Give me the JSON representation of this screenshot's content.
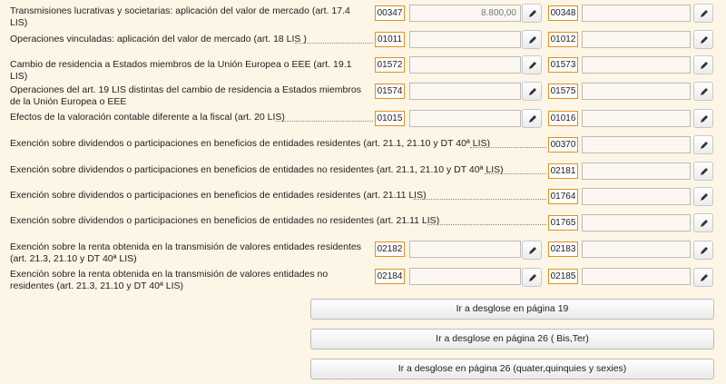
{
  "rows": [
    {
      "label": "Transmisiones lucrativas y societarias: aplicación del valor de mercado (art. 17.4 LIS)",
      "code1": "00347",
      "value1": "8.800,00",
      "code2": "00348",
      "value2": ""
    },
    {
      "label": "Operaciones vinculadas: aplicación del valor de mercado (art. 18 LIS )",
      "code1": "01011",
      "value1": "",
      "code2": "01012",
      "value2": ""
    },
    {
      "label": "Cambio de residencia a Estados miembros de la Unión Europea o EEE (art. 19.1 LIS)",
      "code1": "01572",
      "value1": "",
      "code2": "01573",
      "value2": ""
    },
    {
      "label": "Operaciones del art. 19 LIS distintas del cambio de residencia a Estados miembros de la Unión Europea o EEE",
      "code1": "01574",
      "value1": "",
      "code2": "01575",
      "value2": ""
    },
    {
      "label": "Efectos de la valoración contable diferente a la fiscal (art. 20 LIS)",
      "code1": "01015",
      "value1": "",
      "code2": "01016",
      "value2": ""
    },
    {
      "label": "Exención sobre dividendos o participaciones en beneficios de entidades residentes (art. 21.1, 21.10 y DT 40ª LIS)",
      "code2": "00370",
      "value2": ""
    },
    {
      "label": "Exención sobre dividendos o participaciones en beneficios de entidades no residentes (art. 21.1, 21.10 y DT 40ª LIS)",
      "code2": "02181",
      "value2": ""
    },
    {
      "label": "Exención sobre dividendos o participaciones en beneficios de entidades residentes (art. 21.11 LIS)",
      "code2": "01764",
      "value2": ""
    },
    {
      "label": "Exención sobre dividendos o participaciones en beneficios de entidades no residentes (art. 21.11 LIS)",
      "code2": "01765",
      "value2": ""
    },
    {
      "label": "Exención sobre la renta obtenida en la transmisión de valores entidades residentes (art. 21.3, 21.10 y DT 40ª LIS)",
      "code1": "02182",
      "value1": "",
      "code2": "02183",
      "value2": ""
    },
    {
      "label": "Exención sobre la renta obtenida en la transmisión de valores entidades no residentes (art. 21.3, 21.10 y DT 40ª LIS)",
      "code1": "02184",
      "value1": "",
      "code2": "02185",
      "value2": ""
    }
  ],
  "buttons": {
    "page19": "Ir a desglose en página 19",
    "page26": "Ir a desglose en página 26 ( Bis,Ter)",
    "page26b": "Ir a desglose en página 26 (quater,quinquies y sexies)"
  },
  "icons": {
    "edit": "pencil-icon"
  },
  "colors": {
    "code_border": "#e09020",
    "background": "#fdf5e6"
  }
}
